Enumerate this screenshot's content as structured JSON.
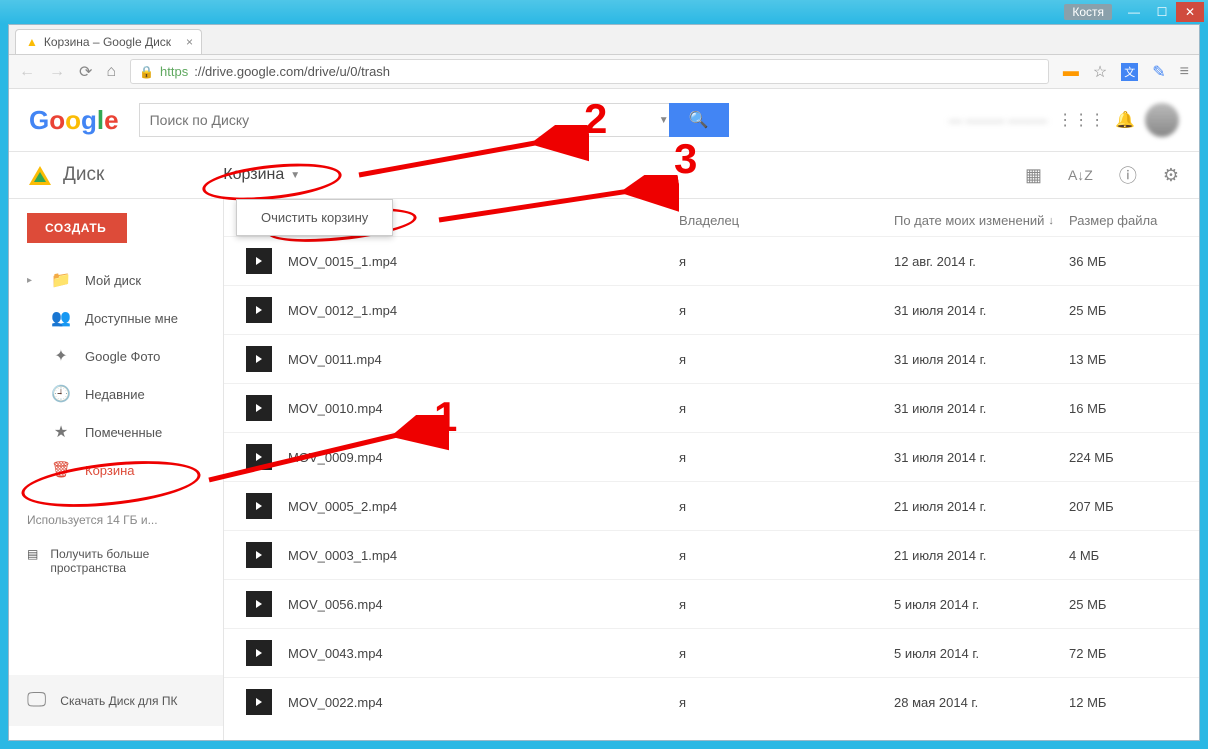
{
  "window": {
    "user": "Костя"
  },
  "browser": {
    "tab_title": "Корзина – Google Диск",
    "url_scheme": "https",
    "url_rest": "://drive.google.com/drive/u/0/trash"
  },
  "header": {
    "logo": "Google",
    "search_placeholder": "Поиск по Диску"
  },
  "subheader": {
    "app_name": "Диск",
    "breadcrumb": "Корзина"
  },
  "menu_popup": {
    "empty_trash": "Очистить корзину"
  },
  "sidebar": {
    "create": "СОЗДАТЬ",
    "items": [
      {
        "label": "Мой диск",
        "icon": "folder",
        "expand": true
      },
      {
        "label": "Доступные мне",
        "icon": "people"
      },
      {
        "label": "Google Фото",
        "icon": "photos"
      },
      {
        "label": "Недавние",
        "icon": "clock"
      },
      {
        "label": "Помеченные",
        "icon": "star"
      },
      {
        "label": "Корзина",
        "icon": "trash",
        "active": true
      }
    ],
    "usage": "Используется 14 ГБ и...",
    "getmore": "Получить больше пространства",
    "download": "Скачать Диск для ПК"
  },
  "columns": {
    "owner": "Владелец",
    "date": "По дате моих изменений",
    "size": "Размер файла"
  },
  "files": [
    {
      "name": "MOV_0015_1.mp4",
      "owner": "я",
      "date": "12 авг. 2014 г.",
      "size": "36 МБ"
    },
    {
      "name": "MOV_0012_1.mp4",
      "owner": "я",
      "date": "31 июля 2014 г.",
      "size": "25 МБ"
    },
    {
      "name": "MOV_0011.mp4",
      "owner": "я",
      "date": "31 июля 2014 г.",
      "size": "13 МБ"
    },
    {
      "name": "MOV_0010.mp4",
      "owner": "я",
      "date": "31 июля 2014 г.",
      "size": "16 МБ"
    },
    {
      "name": "MOV_0009.mp4",
      "owner": "я",
      "date": "31 июля 2014 г.",
      "size": "224 МБ"
    },
    {
      "name": "MOV_0005_2.mp4",
      "owner": "я",
      "date": "21 июля 2014 г.",
      "size": "207 МБ"
    },
    {
      "name": "MOV_0003_1.mp4",
      "owner": "я",
      "date": "21 июля 2014 г.",
      "size": "4 МБ"
    },
    {
      "name": "MOV_0056.mp4",
      "owner": "я",
      "date": "5 июля 2014 г.",
      "size": "25 МБ"
    },
    {
      "name": "MOV_0043.mp4",
      "owner": "я",
      "date": "5 июля 2014 г.",
      "size": "72 МБ"
    },
    {
      "name": "MOV_0022.mp4",
      "owner": "я",
      "date": "28 мая 2014 г.",
      "size": "12 МБ"
    }
  ],
  "annotations": {
    "n1": "1",
    "n2": "2",
    "n3": "3"
  }
}
